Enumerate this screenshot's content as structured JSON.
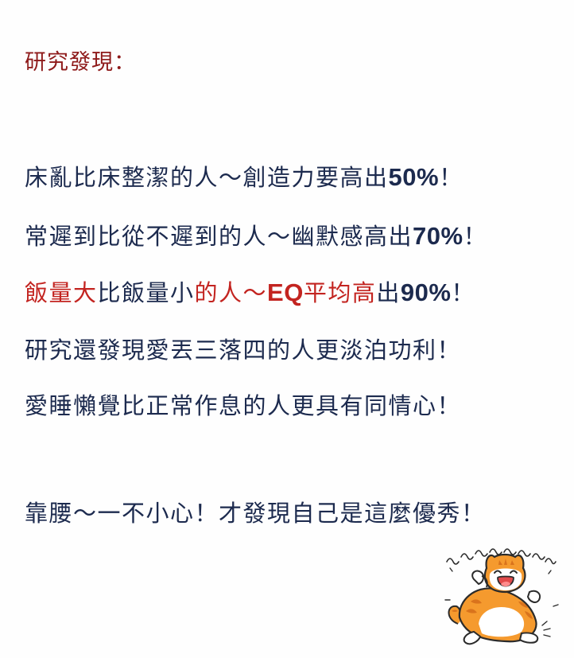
{
  "heading": "研究發現：",
  "lines": [
    {
      "a": "床亂比床整潔的人～創造力要高出",
      "num": "50%",
      "end": "！"
    },
    {
      "a": "常遲到比從不遲到的人～幽默感高出",
      "num": "70%",
      "end": "！"
    },
    {
      "red1": "飯量大",
      "a": "比飯量小",
      "red2": "的人～",
      "redEq": "EQ",
      "red3": "平均高",
      "b": "出",
      "num": "90%",
      "end": "！"
    },
    {
      "a": "研究還發現愛丟三落四的人更淡泊功利！"
    },
    {
      "a": "愛睡懶覺比正常作息的人更具有同情心！"
    },
    {
      "a": "靠腰～一不小心！才發現自己是這麼優秀！"
    }
  ],
  "sticker": {
    "icon": "laughing-cat-sticker",
    "colors": {
      "orange": "#f59a2e",
      "dark_stripe": "#d9731c",
      "outline": "#2b2b2b",
      "mouth": "#e24a4a",
      "tongue": "#ff8c8c"
    }
  }
}
